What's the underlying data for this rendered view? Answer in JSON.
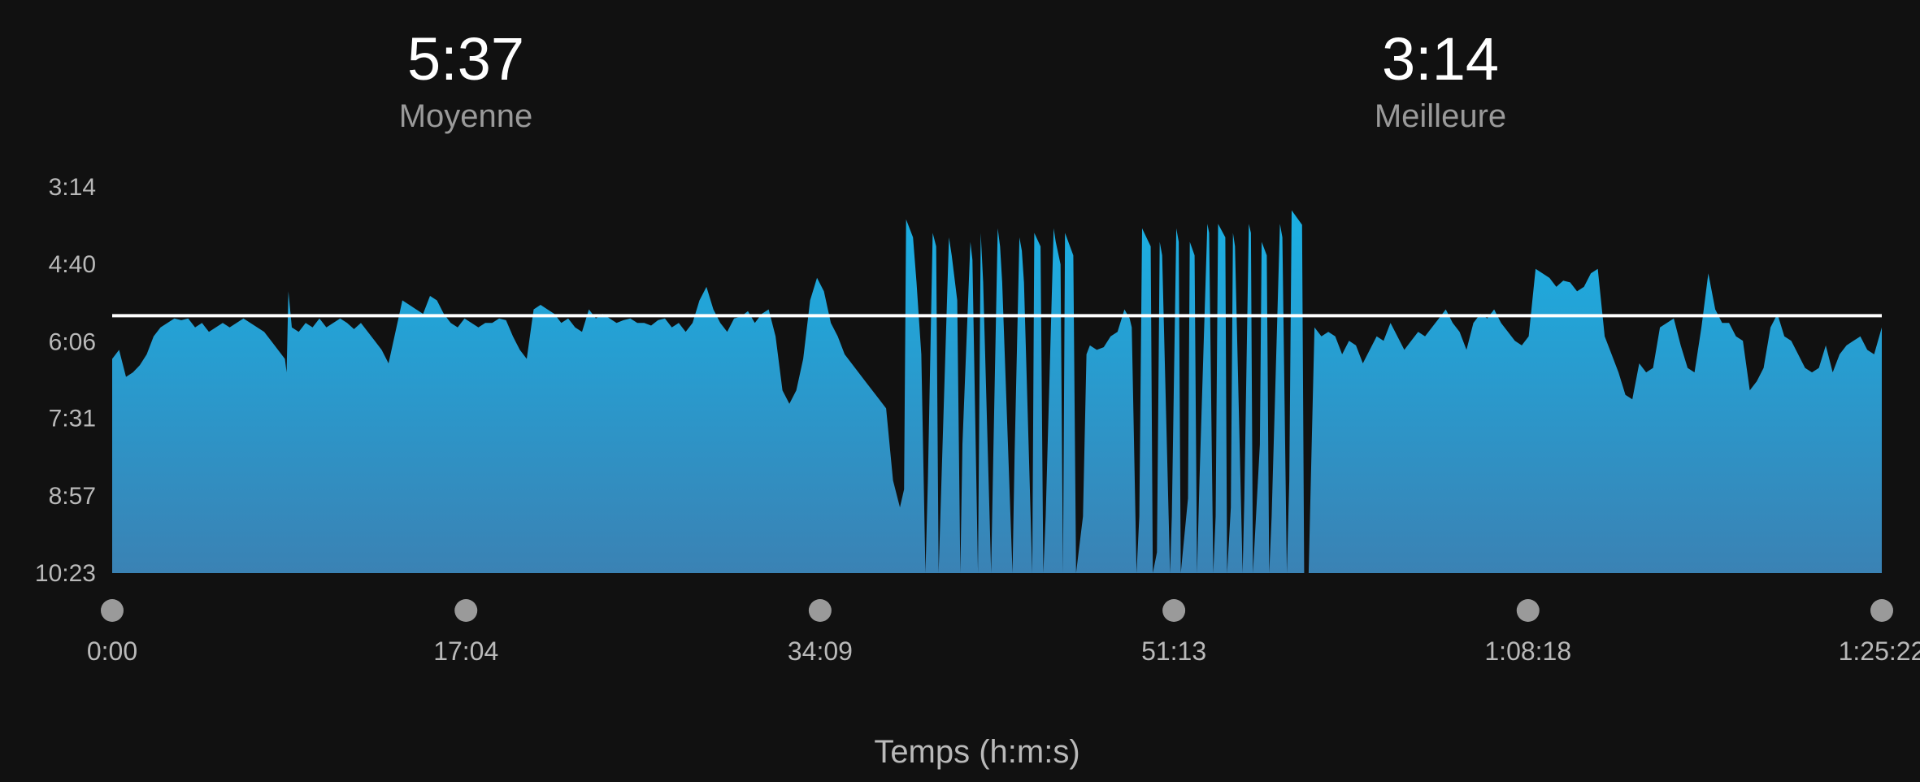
{
  "summary": {
    "average_value": "5:37",
    "average_label": "Moyenne",
    "best_value": "3:14",
    "best_label": "Meilleure"
  },
  "chart_data": {
    "type": "area",
    "title": "",
    "xlabel": "Temps (h:m:s)",
    "ylabel": "",
    "y_unit": "pace min:s",
    "y_inverted": true,
    "ylim": [
      194,
      623
    ],
    "xlim": [
      0,
      5122
    ],
    "x_ticks": [
      {
        "value": 0,
        "label": "0:00"
      },
      {
        "value": 1024,
        "label": "17:04"
      },
      {
        "value": 2049,
        "label": "34:09"
      },
      {
        "value": 3073,
        "label": "51:13"
      },
      {
        "value": 4098,
        "label": "1:08:18"
      },
      {
        "value": 5122,
        "label": "1:25:22"
      }
    ],
    "y_ticks": [
      {
        "value": 194,
        "label": "3:14"
      },
      {
        "value": 280,
        "label": "4:40"
      },
      {
        "value": 366,
        "label": "6:06"
      },
      {
        "value": 451,
        "label": "7:31"
      },
      {
        "value": 537,
        "label": "8:57"
      },
      {
        "value": 623,
        "label": "10:23"
      }
    ],
    "average_line": {
      "value": 337,
      "label": "5:37"
    },
    "grid": false,
    "colors": {
      "fill_top": "#1ab0e4",
      "fill_bottom": "#3a82b4",
      "average_line": "#ffffff",
      "background": "#111111"
    },
    "series": [
      {
        "x": [
          0,
          20,
          40,
          60,
          80,
          100,
          120,
          140,
          160,
          180,
          200,
          220,
          240,
          260,
          280,
          300,
          320,
          340,
          360,
          380,
          400,
          420,
          440,
          460,
          480,
          500,
          505,
          510,
          515,
          520,
          540,
          560,
          580,
          600,
          620,
          640,
          660,
          680,
          700,
          720,
          740,
          760,
          780,
          800,
          820,
          840,
          860,
          880,
          900,
          920,
          940,
          960,
          980,
          1000,
          1020,
          1040,
          1060,
          1080,
          1100,
          1120,
          1140,
          1160,
          1180,
          1200,
          1220,
          1240,
          1260,
          1280,
          1300,
          1320,
          1340,
          1360,
          1380,
          1400,
          1420,
          1440,
          1460,
          1480,
          1500,
          1520,
          1540,
          1560,
          1580,
          1600,
          1620,
          1640,
          1660,
          1680,
          1700,
          1720,
          1740,
          1760,
          1780,
          1800,
          1820,
          1840,
          1860,
          1880,
          1900,
          1920,
          1940,
          1960,
          1980,
          2000,
          2020,
          2040,
          2060,
          2080,
          2100,
          2120,
          2140,
          2160,
          2180,
          2200,
          2220,
          2240,
          2260,
          2280,
          2292,
          2298,
          2318,
          2328,
          2342,
          2354,
          2361,
          2375,
          2385,
          2392,
          2422,
          2430,
          2446,
          2455,
          2461,
          2484,
          2490,
          2506,
          2514,
          2521,
          2544,
          2550,
          2563,
          2570,
          2576,
          2606,
          2612,
          2626,
          2633,
          2639,
          2663,
          2669,
          2687,
          2695,
          2702,
          2725,
          2731,
          2745,
          2752,
          2758,
          2782,
          2790,
          2810,
          2820,
          2830,
          2850,
          2870,
          2890,
          2910,
          2930,
          2945,
          2951,
          2965,
          2973,
          2981,
          3006,
          3012,
          3024,
          3032,
          3039,
          3062,
          3067,
          3080,
          3087,
          3093,
          3114,
          3119,
          3133,
          3140,
          3147,
          3170,
          3175,
          3187,
          3194,
          3201,
          3222,
          3227,
          3238,
          3244,
          3250,
          3272,
          3277,
          3290,
          3296,
          3302,
          3322,
          3327,
          3342,
          3349,
          3356,
          3380,
          3387,
          3400,
          3407,
          3414,
          3444,
          3450,
          3463,
          3480,
          3500,
          3520,
          3540,
          3560,
          3580,
          3600,
          3620,
          3640,
          3660,
          3680,
          3700,
          3720,
          3740,
          3760,
          3780,
          3800,
          3820,
          3840,
          3860,
          3880,
          3900,
          3920,
          3940,
          3960,
          3980,
          4000,
          4020,
          4040,
          4060,
          4080,
          4100,
          4120,
          4140,
          4160,
          4180,
          4200,
          4220,
          4240,
          4260,
          4280,
          4300,
          4320,
          4340,
          4360,
          4380,
          4400,
          4420,
          4440,
          4460,
          4480,
          4500,
          4520,
          4540,
          4560,
          4580,
          4600,
          4620,
          4640,
          4660,
          4680,
          4700,
          4720,
          4740,
          4760,
          4780,
          4800,
          4820,
          4840,
          4860,
          4880,
          4900,
          4920,
          4940,
          4960,
          4980,
          5000,
          5020,
          5040,
          5060,
          5080,
          5100,
          5122
        ],
        "y": [
          385,
          375,
          405,
          400,
          392,
          380,
          360,
          350,
          345,
          340,
          342,
          340,
          350,
          345,
          355,
          350,
          345,
          350,
          345,
          340,
          345,
          350,
          355,
          365,
          375,
          385,
          400,
          310,
          330,
          350,
          355,
          345,
          350,
          340,
          350,
          345,
          340,
          345,
          352,
          345,
          355,
          365,
          375,
          390,
          355,
          320,
          325,
          330,
          335,
          315,
          320,
          335,
          345,
          350,
          340,
          345,
          350,
          345,
          345,
          340,
          342,
          360,
          375,
          385,
          330,
          325,
          330,
          335,
          345,
          340,
          350,
          355,
          330,
          340,
          335,
          340,
          345,
          342,
          340,
          345,
          345,
          348,
          342,
          340,
          350,
          345,
          355,
          345,
          320,
          305,
          330,
          345,
          355,
          340,
          338,
          332,
          345,
          335,
          330,
          360,
          420,
          435,
          420,
          385,
          320,
          295,
          310,
          345,
          360,
          380,
          390,
          400,
          410,
          420,
          430,
          440,
          520,
          550,
          530,
          230,
          250,
          300,
          380,
          623,
          520,
          245,
          260,
          623,
          250,
          270,
          320,
          623,
          480,
          255,
          275,
          623,
          245,
          300,
          623,
          500,
          240,
          260,
          300,
          623,
          490,
          250,
          265,
          300,
          623,
          245,
          260,
          623,
          560,
          240,
          255,
          280,
          623,
          245,
          270,
          623,
          560,
          380,
          370,
          375,
          372,
          360,
          355,
          330,
          340,
          350,
          623,
          560,
          240,
          260,
          623,
          600,
          255,
          270,
          623,
          560,
          240,
          255,
          623,
          540,
          255,
          270,
          623,
          520,
          235,
          245,
          623,
          560,
          235,
          250,
          623,
          550,
          245,
          260,
          623,
          540,
          235,
          245,
          623,
          480,
          255,
          270,
          623,
          560,
          235,
          250,
          623,
          520,
          220,
          236,
          623,
          623,
          350,
          360,
          355,
          360,
          380,
          365,
          370,
          390,
          375,
          360,
          365,
          345,
          360,
          375,
          365,
          355,
          360,
          350,
          340,
          330,
          345,
          355,
          375,
          345,
          335,
          340,
          330,
          345,
          355,
          365,
          370,
          360,
          285,
          290,
          295,
          305,
          298,
          300,
          310,
          305,
          290,
          285,
          360,
          380,
          400,
          425,
          430,
          390,
          400,
          395,
          350,
          345,
          340,
          370,
          395,
          400,
          350,
          290,
          330,
          345,
          345,
          360,
          365,
          420,
          410,
          395,
          350,
          335,
          360,
          365,
          380,
          395,
          400,
          395,
          370,
          400,
          380,
          370,
          365,
          360,
          375,
          380,
          350
        ]
      }
    ]
  }
}
